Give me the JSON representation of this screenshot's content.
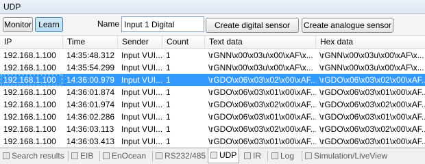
{
  "window": {
    "title": "UDP"
  },
  "toolbar": {
    "monitor_label": "Monitor",
    "learn_label": "Learn",
    "name_label": "Name",
    "name_value": "Input 1 Digital",
    "create_digital_label": "Create digital sensor",
    "create_analogue_label": "Create analogue sensor"
  },
  "table": {
    "columns": [
      "IP",
      "Time",
      "Sender",
      "Count",
      "Text data",
      "Hex data"
    ],
    "rows": [
      {
        "ip": "192.168.1.100",
        "time": "14:35:48.312",
        "sender": "Input VUI...",
        "count": "1",
        "text": "\\rGNN\\x00\\x03u\\x00\\xAF\\x...",
        "hex": "\\rGNN\\x00\\x03u\\x00\\xAF\\x..."
      },
      {
        "ip": "192.168.1.100",
        "time": "14:35:54.299",
        "sender": "Input VUI...",
        "count": "1",
        "text": "\\rGNN\\x00\\x03u\\x00\\xAF\\x...",
        "hex": "\\rGNN\\x00\\x03u\\x00\\xAF\\x..."
      },
      {
        "ip": "192.168.1.100",
        "time": "14:36:00.979",
        "sender": "Input VUI...",
        "count": "1",
        "text": "\\rGDO\\x06\\x03\\x02\\x00\\xAF...",
        "hex": "\\rGDO\\x06\\x03\\x02\\x00\\xAF..."
      },
      {
        "ip": "192.168.1.100",
        "time": "14:36:01.874",
        "sender": "Input VUI...",
        "count": "1",
        "text": "\\rGDO\\x06\\x03\\x01\\x00\\xAF...",
        "hex": "\\rGDO\\x06\\x03\\x01\\x00\\xAF..."
      },
      {
        "ip": "192.168.1.100",
        "time": "14:36:01.974",
        "sender": "Input VUI...",
        "count": "1",
        "text": "\\rGDO\\x06\\x03\\x02\\x00\\xAF...",
        "hex": "\\rGDO\\x06\\x03\\x02\\x00\\xAF..."
      },
      {
        "ip": "192.168.1.100",
        "time": "14:36:02.286",
        "sender": "Input VUI...",
        "count": "1",
        "text": "\\rGDO\\x06\\x03\\x01\\x00\\xAF...",
        "hex": "\\rGDO\\x06\\x03\\x01\\x00\\xAF..."
      },
      {
        "ip": "192.168.1.100",
        "time": "14:36:03.113",
        "sender": "Input VUI...",
        "count": "1",
        "text": "\\rGDO\\x06\\x03\\x02\\x00\\xAF...",
        "hex": "\\rGDO\\x06\\x03\\x02\\x00\\xAF..."
      },
      {
        "ip": "192.168.1.100",
        "time": "14:36:03.413",
        "sender": "Input VUI...",
        "count": "1",
        "text": "\\rGDO\\x06\\x03\\x01\\x00\\xAF...",
        "hex": "\\rGDO\\x06\\x03\\x01\\x00\\xAF..."
      }
    ],
    "selected_row": 2
  },
  "tabs": {
    "search_results": "Search results",
    "eib": "EIB",
    "enocean": "EnOcean",
    "rs232": "RS232/485",
    "udp": "UDP",
    "ir": "IR",
    "log": "Log",
    "simulation": "Simulation/LiveView",
    "active": "udp"
  },
  "colors": {
    "selection": "#3399ff",
    "pressed_button": "#b8dcf2"
  }
}
